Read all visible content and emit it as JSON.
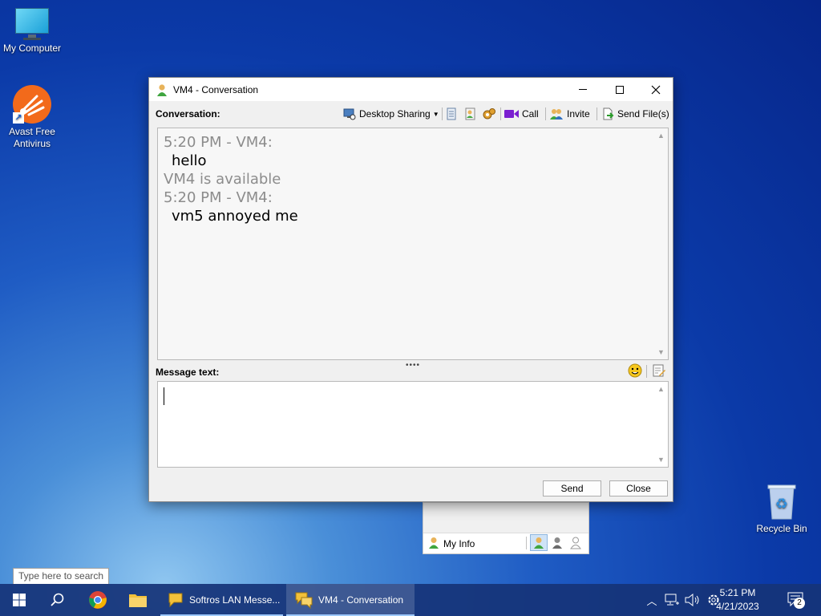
{
  "desktop": {
    "icons": [
      {
        "label": "My Computer",
        "icon": "monitor-icon"
      },
      {
        "label": "Avast Free Antivirus",
        "icon": "avast-icon"
      },
      {
        "label": "Recycle Bin",
        "icon": "recycle-bin-icon"
      }
    ]
  },
  "window": {
    "title": "VM4 - Conversation",
    "conversation_label": "Conversation:",
    "toolbar": {
      "desktop_sharing": "Desktop Sharing",
      "call": "Call",
      "invite": "Invite",
      "send_files": "Send File(s)"
    },
    "conversation": [
      {
        "kind": "meta",
        "text": "5:20 PM - VM4:"
      },
      {
        "kind": "msg",
        "text": "hello"
      },
      {
        "kind": "meta",
        "text": "VM4 is available"
      },
      {
        "kind": "meta",
        "text": "5:20 PM - VM4:"
      },
      {
        "kind": "msg",
        "text": "vm5 annoyed me"
      }
    ],
    "message_label": "Message text:",
    "message_value": "",
    "send_label": "Send",
    "close_label": "Close"
  },
  "contact_panel": {
    "my_info": "My Info"
  },
  "taskbar": {
    "search_tooltip": "Type here to search",
    "apps": [
      {
        "label": "Softros LAN Messe...",
        "icon": "softros-icon"
      },
      {
        "label": "VM4 - Conversation",
        "icon": "softros-chat-icon"
      }
    ],
    "time": "5:21 PM",
    "date": "4/21/2023",
    "notification_count": "2"
  },
  "colors": {
    "accent": "#1a5fd0",
    "meta_text": "#8c8c8c",
    "call_icon": "#7a1fd0"
  }
}
